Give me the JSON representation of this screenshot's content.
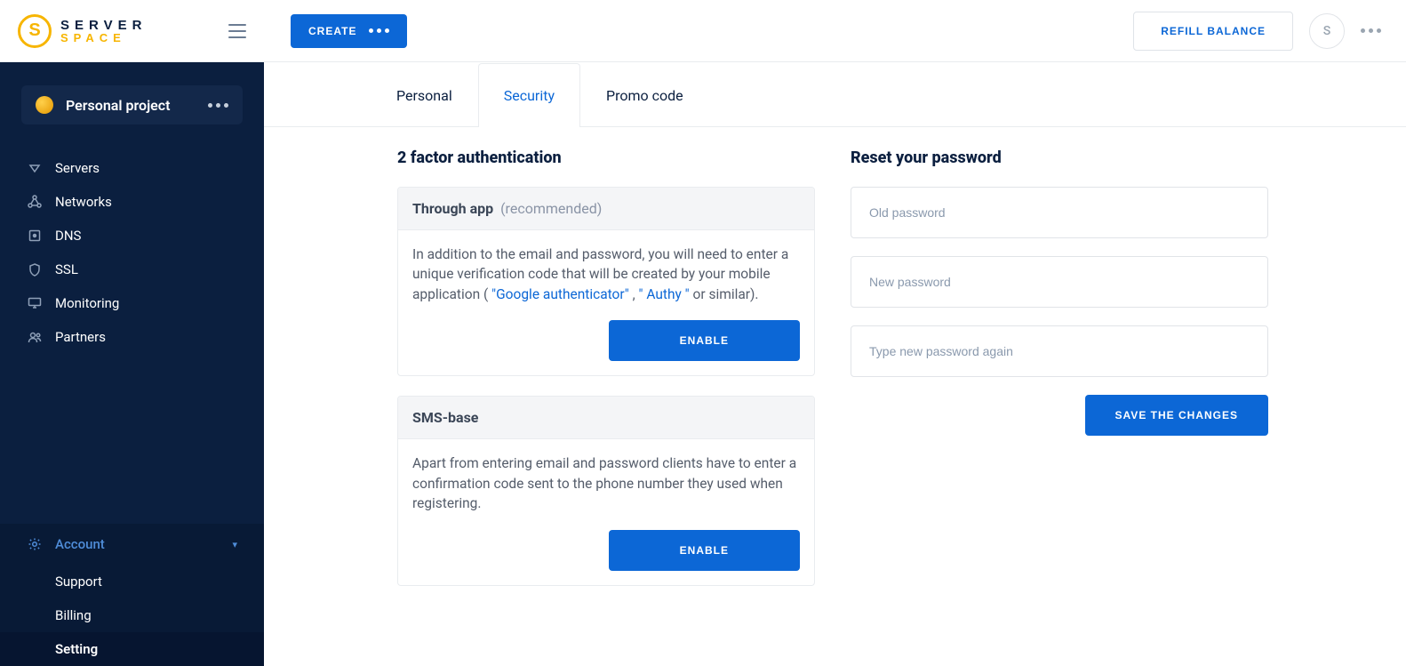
{
  "brand": {
    "top": "SERVER",
    "bottom": "SPACE",
    "mark": "S"
  },
  "topbar": {
    "create_label": "CREATE",
    "refill_label": "REFILL BALANCE",
    "avatar_initial": "S"
  },
  "sidebar": {
    "project_name": "Personal project",
    "items": [
      {
        "label": "Servers",
        "icon": "triangle"
      },
      {
        "label": "Networks",
        "icon": "nodes"
      },
      {
        "label": "DNS",
        "icon": "square-dot"
      },
      {
        "label": "SSL",
        "icon": "shield"
      },
      {
        "label": "Monitoring",
        "icon": "monitor"
      },
      {
        "label": "Partners",
        "icon": "users"
      }
    ],
    "account": {
      "label": "Account",
      "children": [
        {
          "label": "Support",
          "active": false
        },
        {
          "label": "Billing",
          "active": false
        },
        {
          "label": "Setting",
          "active": true
        }
      ]
    }
  },
  "tabs": [
    {
      "label": "Personal",
      "active": false
    },
    {
      "label": "Security",
      "active": true
    },
    {
      "label": "Promo code",
      "active": false
    }
  ],
  "twofa": {
    "title": "2 factor authentication",
    "app": {
      "title": "Through app",
      "hint": "(recommended)",
      "desc_pre": "In addition to the email and password, you will need to enter a unique verification code that will be created by your mobile application ( ",
      "link1": "\"Google authenticator\"",
      "sep": " , ",
      "link2": "\" Authy \"",
      "desc_post": " or similar).",
      "button": "ENABLE"
    },
    "sms": {
      "title": "SMS-base",
      "desc": "Apart from entering email and password clients have to enter a confirmation code sent to the phone number they used when registering.",
      "button": "ENABLE"
    }
  },
  "password": {
    "title": "Reset your password",
    "old_ph": "Old password",
    "new_ph": "New password",
    "again_ph": "Type new password again",
    "save_label": "SAVE THE CHANGES"
  }
}
